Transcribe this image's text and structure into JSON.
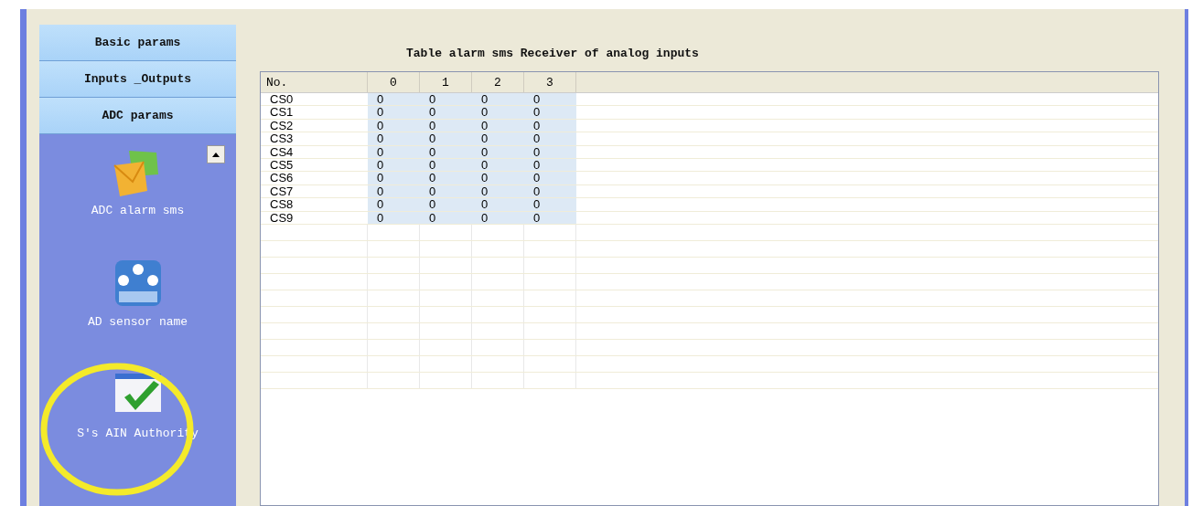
{
  "sidebar": {
    "tabs": [
      {
        "label": "Basic params"
      },
      {
        "label": "Inputs _Outputs"
      },
      {
        "label": "ADC params"
      }
    ],
    "items": [
      {
        "label": "ADC alarm sms",
        "kind": "mail"
      },
      {
        "label": "AD sensor name",
        "kind": "sensor"
      },
      {
        "label": "S's AIN Authority",
        "kind": "check"
      }
    ]
  },
  "table": {
    "title": "Table alarm sms Receiver of analog inputs",
    "columns": [
      "No.",
      "0",
      "1",
      "2",
      "3"
    ],
    "rows": [
      [
        "CS0",
        "0",
        "0",
        "0",
        "0"
      ],
      [
        "CS1",
        "0",
        "0",
        "0",
        "0"
      ],
      [
        "CS2",
        "0",
        "0",
        "0",
        "0"
      ],
      [
        "CS3",
        "0",
        "0",
        "0",
        "0"
      ],
      [
        "CS4",
        "0",
        "0",
        "0",
        "0"
      ],
      [
        "CS5",
        "0",
        "0",
        "0",
        "0"
      ],
      [
        "CS6",
        "0",
        "0",
        "0",
        "0"
      ],
      [
        "CS7",
        "0",
        "0",
        "0",
        "0"
      ],
      [
        "CS8",
        "0",
        "0",
        "0",
        "0"
      ],
      [
        "CS9",
        "0",
        "0",
        "0",
        "0"
      ]
    ]
  }
}
